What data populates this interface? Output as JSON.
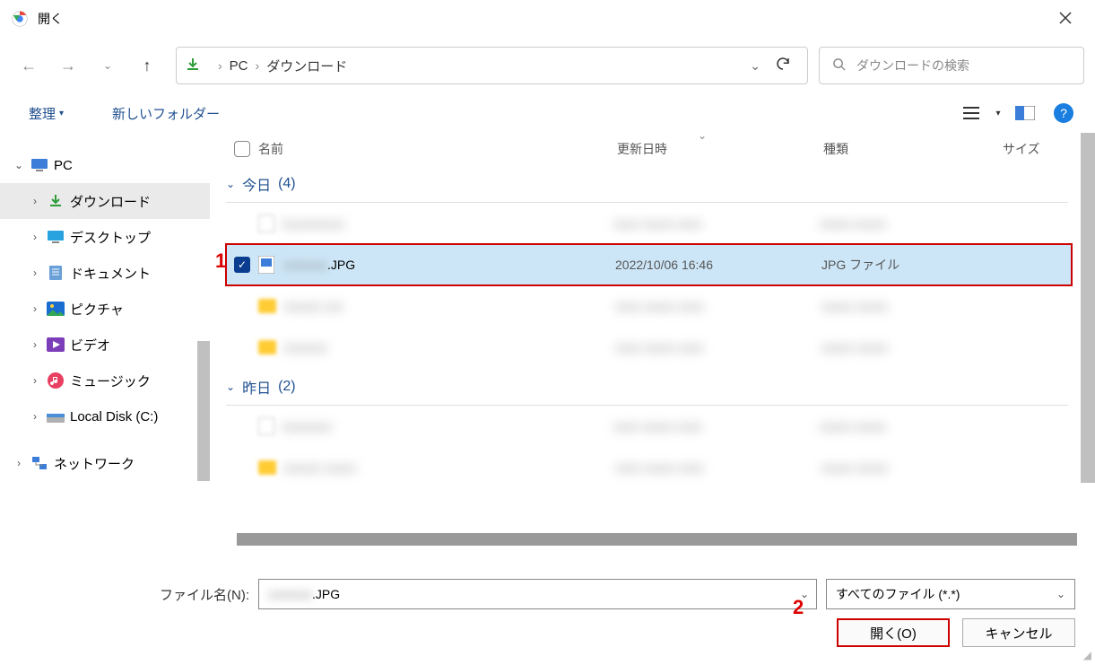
{
  "window": {
    "title": "開く"
  },
  "breadcrumb": {
    "seg1": "PC",
    "seg2": "ダウンロード"
  },
  "search": {
    "placeholder": "ダウンロードの検索"
  },
  "toolbar": {
    "organize": "整理",
    "newFolder": "新しいフォルダー"
  },
  "columns": {
    "name": "名前",
    "date": "更新日時",
    "type": "種類",
    "size": "サイズ"
  },
  "groups": {
    "today": {
      "label": "今日",
      "count": "(4)"
    },
    "yesterday": {
      "label": "昨日",
      "count": "(2)"
    }
  },
  "tree": {
    "pc": "PC",
    "downloads": "ダウンロード",
    "desktop": "デスクトップ",
    "documents": "ドキュメント",
    "pictures": "ピクチャ",
    "videos": "ビデオ",
    "music": "ミュージック",
    "localdisk": "Local Disk (C:)",
    "network": "ネットワーク"
  },
  "selectedFile": {
    "nameBlur": "xxxxxxx",
    "ext": ".JPG",
    "date": "2022/10/06 16:46",
    "type": "JPG ファイル"
  },
  "blurred": {
    "r1": {
      "name": "xxxxxxxxxx",
      "date": "xxxx xxxxx xxxx",
      "type": "xxxxx xxxxx"
    },
    "r3": {
      "name": "xxxxxx xxx",
      "date": "xxxx xxxxx xxxx",
      "type": "xxxxx xxxxx"
    },
    "r4": {
      "name": "xxxxxxx",
      "date": "xxxx xxxxx xxxx",
      "type": "xxxxx xxxxx"
    },
    "r5": {
      "name": "xxxxxxxx",
      "date": "xxxx xxxxx xxxx",
      "type": "xxxxx xxxxx"
    },
    "r6": {
      "name": "xxxxxx xxxxx",
      "date": "xxxx xxxxx xxxx",
      "type": "xxxxx xxxxx"
    }
  },
  "footer": {
    "fileNameLabel": "ファイル名(N):",
    "fileTypeSel": "すべてのファイル (*.*)",
    "open": "開く(O)",
    "cancel": "キャンセル"
  },
  "annot": {
    "one": "1",
    "two": "2"
  }
}
